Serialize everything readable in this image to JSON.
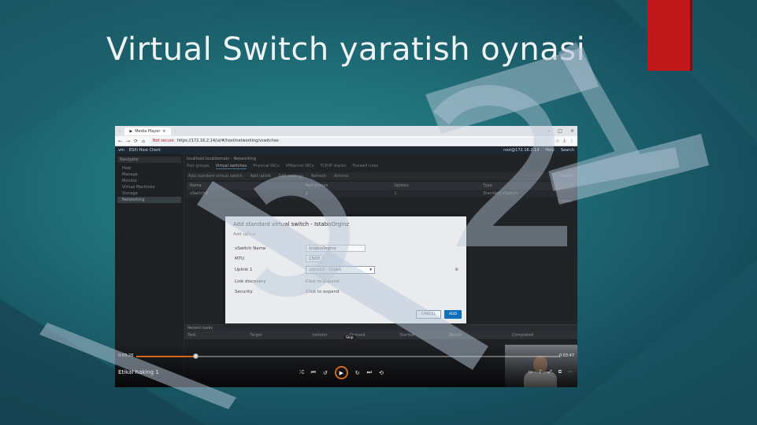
{
  "slide": {
    "title": "Virtual Switch yaratish oynasi",
    "accent_color": "#c0171a"
  },
  "browser": {
    "tab_label": "Media Player",
    "not_secure": "Not secure",
    "url": "https://172.16.2.14/ui/#/host/networking/vswitches",
    "icons": [
      "back-icon",
      "forward-icon",
      "reload-icon",
      "home-icon",
      "star-icon",
      "download-icon",
      "menu-icon"
    ]
  },
  "esxi": {
    "product": "ESXi Host Client",
    "user": "root@172.16.2.14",
    "help": "Help",
    "search": "Search",
    "navigator": "Navigator",
    "nav_items": [
      "Host",
      "Manage",
      "Monitor",
      "Virtual Machines",
      "Storage",
      "Networking"
    ],
    "breadcrumb": "localhost.localdomain - Networking",
    "subtabs": [
      "Port groups",
      "Virtual switches",
      "Physical NICs",
      "VMkernel NICs",
      "TCP/IP stacks",
      "Firewall rules"
    ],
    "toolbar": [
      "Add standard virtual switch",
      "Add uplink",
      "Edit settings",
      "Refresh",
      "Actions"
    ],
    "columns": [
      "Name",
      "Port groups",
      "Uplinks",
      "Type"
    ],
    "row": [
      "vSwitch0",
      "2",
      "1",
      "Standard vSwitch"
    ],
    "items_count": "1 items",
    "tasks_title": "Recent tasks",
    "task_columns": [
      "Task",
      "Target",
      "Initiator",
      "Queued",
      "Started",
      "Result",
      "Completed"
    ]
  },
  "modal": {
    "title": "Add standard virtual switch - IstaboOrginz",
    "subtitle": "Add uplink",
    "fields": [
      {
        "label": "vSwitch Name",
        "value": "IstaboOrginz"
      },
      {
        "label": "MTU",
        "value": "1500"
      },
      {
        "label": "Uplink 1",
        "value": "vmnic0 - Down"
      }
    ],
    "link_discovery": {
      "label": "Link discovery",
      "value": "Click to expand"
    },
    "security": {
      "label": "Security",
      "value": "Click to expand"
    },
    "cancel": "CANCEL",
    "add": "ADD"
  },
  "player": {
    "time_elapsed": "0:03:28",
    "time_total": "0:03:47",
    "title": "Etikal haking 1",
    "tooltip": "Skip",
    "progress": 0.14
  }
}
